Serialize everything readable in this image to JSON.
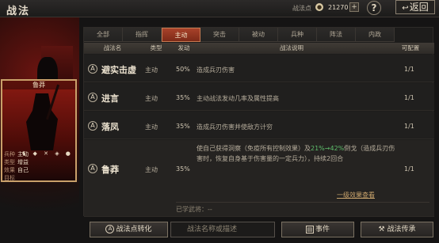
{
  "header": {
    "title": "战法",
    "points_label": "战法点",
    "points_icon": "●",
    "points_value": "21270",
    "add": "+",
    "help": "?",
    "back": "返回"
  },
  "card": {
    "name": "鲁莽",
    "stats": [
      [
        "兵种",
        "主动"
      ],
      [
        "类型",
        "增益"
      ],
      [
        "效果",
        "自己"
      ],
      [
        "目标",
        ""
      ]
    ],
    "icons": "♞ ◆ ✕ ◈ ●"
  },
  "tabs": [
    "全部",
    "指挥",
    "主动",
    "突击",
    "被动",
    "兵种",
    "阵法",
    "内政"
  ],
  "active_tab": 2,
  "columns": [
    "战法名",
    "类型",
    "发动",
    "战法说明",
    "可配置"
  ],
  "rows": [
    {
      "icon": "A",
      "name": "避实击虚",
      "type": "主动",
      "rate": "50%",
      "desc": "造成兵刃伤害",
      "count": "1/1"
    },
    {
      "icon": "A",
      "name": "进言",
      "type": "主动",
      "rate": "35%",
      "desc": "主动战法发动几率及属性提高",
      "count": "1/1"
    },
    {
      "icon": "A",
      "name": "落凤",
      "type": "主动",
      "rate": "35%",
      "desc": "造成兵刃伤害并使敌方计穷",
      "count": "1/1"
    },
    {
      "icon": "A",
      "name": "鲁莽",
      "type": "主动",
      "rate": "35%",
      "desc_a": "使自己获得洞察（免疫所有控制效果）及",
      "desc_hl": "21%→42%",
      "desc_b": "倒戈（造成兵刃伤害时，恢复自身基于伤害量的一定兵力），持续2回合",
      "count": "1/1",
      "link": "一级效果查看",
      "learned": "已学武将：--"
    }
  ],
  "bottom": {
    "convert": "战法点转化",
    "search_placeholder": "战法名称或描述",
    "event": "事件",
    "inherit": "战法传承"
  }
}
